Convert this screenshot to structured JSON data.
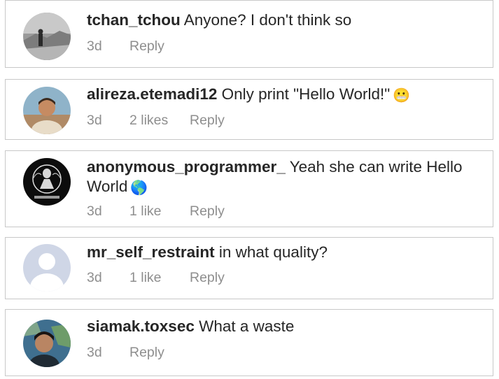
{
  "comments": [
    {
      "username": "tchan_tchou",
      "text": "Anyone? I don't think so",
      "time": "3d",
      "likes": "",
      "reply": "Reply",
      "emoji": ""
    },
    {
      "username": "alireza.etemadi12",
      "text": "Only print \"Hello World!\"",
      "time": "3d",
      "likes": "2 likes",
      "reply": "Reply",
      "emoji": "😬"
    },
    {
      "username": "anonymous_programmer_",
      "text": "Yeah she can write Hello World",
      "time": "3d",
      "likes": "1 like",
      "reply": "Reply",
      "emoji": "🌎"
    },
    {
      "username": "mr_self_restraint",
      "text": "in what quality?",
      "time": "3d",
      "likes": "1 like",
      "reply": "Reply",
      "emoji": ""
    },
    {
      "username": "siamak.toxsec",
      "text": "What a waste",
      "time": "3d",
      "likes": "",
      "reply": "Reply",
      "emoji": ""
    }
  ]
}
